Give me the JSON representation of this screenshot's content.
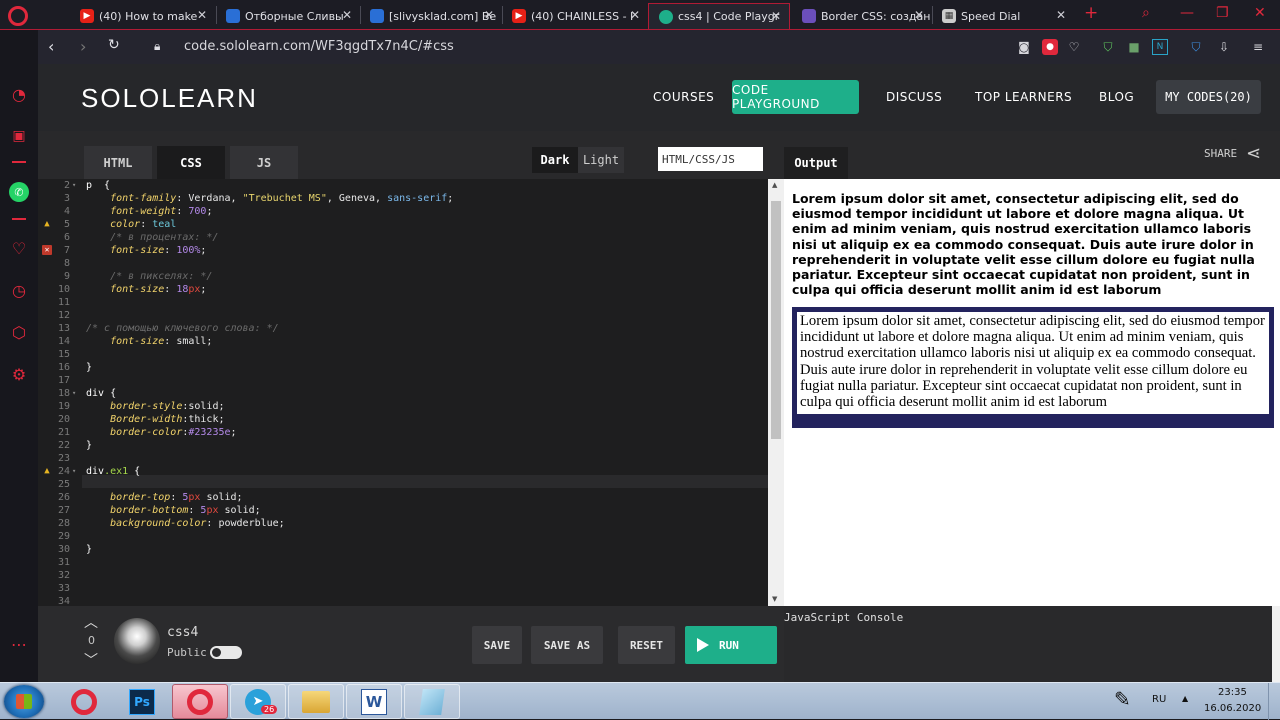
{
  "browser": {
    "tabs": [
      {
        "title": "(40) How to make",
        "icon_color": "#e62117",
        "icon": "youtube-icon"
      },
      {
        "title": "Отборные Сливы",
        "icon_color": "#2a6fd6",
        "icon": "site-icon"
      },
      {
        "title": "[slivysklad.com] Be",
        "icon_color": "#2a6fd6",
        "icon": "site-icon"
      },
      {
        "title": "(40) CHAINLESS - I",
        "icon_color": "#e62117",
        "icon": "youtube-icon"
      },
      {
        "title": "css4 | Code Playgr",
        "icon_color": "#1eaf8a",
        "icon": "sololearn-icon",
        "active": true
      },
      {
        "title": "Border CSS: создан",
        "icon_color": "#6b4fbb",
        "icon": "shield-icon"
      },
      {
        "title": "Speed Dial",
        "icon_color": "#cccccc",
        "icon": "grid-icon"
      }
    ],
    "new_tab_label": "+",
    "url": "code.sololearn.com/WF3qgdTx7n4C/#css"
  },
  "header": {
    "logo": "SOLOLEARN",
    "nav": [
      "COURSES",
      "CODE PLAYGROUND",
      "DISCUSS",
      "TOP LEARNERS",
      "BLOG",
      "MY CODES(20)"
    ]
  },
  "editor": {
    "tabs": [
      "HTML",
      "CSS",
      "JS"
    ],
    "active_tab": "CSS",
    "theme_dark": "Dark",
    "theme_light": "Light",
    "language_box": "HTML/CSS/JS"
  },
  "code_lines": [
    {
      "n": "2",
      "fold": true,
      "parts": [
        [
          "k",
          "p  {"
        ]
      ]
    },
    {
      "n": "3",
      "parts": [
        [
          "v",
          "    "
        ],
        [
          "p",
          "font-family"
        ],
        [
          "v",
          ": Verdana, "
        ],
        [
          "s",
          "\"Trebuchet MS\""
        ],
        [
          "v",
          ", Geneva, "
        ],
        [
          "vbl",
          "sans-serif"
        ],
        [
          "v",
          ";"
        ]
      ]
    },
    {
      "n": "4",
      "parts": [
        [
          "v",
          "    "
        ],
        [
          "p",
          "font-weight"
        ],
        [
          "v",
          ": "
        ],
        [
          "n",
          "700"
        ],
        [
          "v",
          ";"
        ]
      ]
    },
    {
      "n": "5",
      "mark": "warn",
      "parts": [
        [
          "v",
          "    "
        ],
        [
          "p",
          "color"
        ],
        [
          "v",
          ": "
        ],
        [
          "vt",
          "teal"
        ]
      ]
    },
    {
      "n": "6",
      "parts": [
        [
          "c",
          "    /* в процентах: */"
        ]
      ]
    },
    {
      "n": "7",
      "mark": "err",
      "parts": [
        [
          "v",
          "    "
        ],
        [
          "p",
          "font-size"
        ],
        [
          "v",
          ": "
        ],
        [
          "n",
          "100%"
        ],
        [
          "v",
          ";"
        ]
      ]
    },
    {
      "n": "8",
      "parts": []
    },
    {
      "n": "9",
      "parts": [
        [
          "c",
          "    /* в пикселях: */"
        ]
      ]
    },
    {
      "n": "10",
      "parts": [
        [
          "v",
          "    "
        ],
        [
          "p",
          "font-size"
        ],
        [
          "v",
          ": "
        ],
        [
          "n",
          "18"
        ],
        [
          "u",
          "px"
        ],
        [
          "v",
          ";"
        ]
      ]
    },
    {
      "n": "11",
      "parts": []
    },
    {
      "n": "12",
      "parts": []
    },
    {
      "n": "13",
      "parts": [
        [
          "c",
          "/* с помощью ключевого слова: */"
        ]
      ]
    },
    {
      "n": "14",
      "parts": [
        [
          "v",
          "    "
        ],
        [
          "p",
          "font-size"
        ],
        [
          "v",
          ": small;"
        ]
      ]
    },
    {
      "n": "15",
      "parts": []
    },
    {
      "n": "16",
      "parts": [
        [
          "k",
          "}"
        ]
      ]
    },
    {
      "n": "17",
      "parts": []
    },
    {
      "n": "18",
      "fold": true,
      "parts": [
        [
          "k",
          "div {"
        ]
      ]
    },
    {
      "n": "19",
      "parts": [
        [
          "v",
          "    "
        ],
        [
          "p",
          "border-style"
        ],
        [
          "v",
          ":solid;"
        ]
      ]
    },
    {
      "n": "20",
      "parts": [
        [
          "v",
          "    "
        ],
        [
          "p",
          "Border-width"
        ],
        [
          "v",
          ":thick;"
        ]
      ]
    },
    {
      "n": "21",
      "parts": [
        [
          "v",
          "    "
        ],
        [
          "p",
          "border-color"
        ],
        [
          "v",
          ":"
        ],
        [
          "n",
          "#23235e"
        ],
        [
          "v",
          ";"
        ]
      ]
    },
    {
      "n": "22",
      "parts": [
        [
          "k",
          "}"
        ]
      ]
    },
    {
      "n": "23",
      "parts": []
    },
    {
      "n": "24",
      "fold": true,
      "mark": "warn",
      "parts": [
        [
          "k",
          "div"
        ],
        [
          "g",
          ".ex1"
        ],
        [
          "k",
          " {"
        ]
      ]
    },
    {
      "n": "25",
      "parts": []
    },
    {
      "n": "26",
      "parts": [
        [
          "v",
          "    "
        ],
        [
          "p",
          "border-top"
        ],
        [
          "v",
          ": "
        ],
        [
          "n",
          "5"
        ],
        [
          "u",
          "px"
        ],
        [
          "v",
          " solid;"
        ]
      ]
    },
    {
      "n": "27",
      "parts": [
        [
          "v",
          "    "
        ],
        [
          "p",
          "border-bottom"
        ],
        [
          "v",
          ": "
        ],
        [
          "n",
          "5"
        ],
        [
          "u",
          "px"
        ],
        [
          "v",
          " solid;"
        ]
      ]
    },
    {
      "n": "28",
      "parts": [
        [
          "v",
          "    "
        ],
        [
          "p",
          "background-color"
        ],
        [
          "v",
          ": powderblue;"
        ]
      ]
    },
    {
      "n": "29",
      "parts": []
    },
    {
      "n": "30",
      "parts": [
        [
          "k",
          "}"
        ]
      ]
    },
    {
      "n": "31",
      "parts": []
    },
    {
      "n": "32",
      "parts": []
    },
    {
      "n": "33",
      "parts": []
    },
    {
      "n": "34",
      "parts": []
    }
  ],
  "output": {
    "tab": "Output",
    "share": "SHARE",
    "paragraph": "Lorem ipsum dolor sit amet, consectetur adipiscing elit, sed do eiusmod tempor incididunt ut labore et dolore magna aliqua. Ut enim ad minim veniam, quis nostrud exercitation ullamco laboris nisi ut aliquip ex ea commodo consequat. Duis aute irure dolor in reprehenderit in voluptate velit esse cillum dolore eu fugiat nulla pariatur. Excepteur sint occaecat cupidatat non proident, sunt in culpa qui officia deserunt mollit anim id est laborum",
    "div_text": "Lorem ipsum dolor sit amet, consectetur adipiscing elit, sed do eiusmod tempor incididunt ut labore et dolore magna aliqua. Ut enim ad minim veniam, quis nostrud exercitation ullamco laboris nisi ut aliquip ex ea commodo consequat. Duis aute irure dolor in reprehenderit in voluptate velit esse cillum dolore eu fugiat nulla pariatur. Excepteur sint occaecat cupidatat non proident, sunt in culpa qui officia deserunt mollit anim id est laborum",
    "border_color": "#23235e"
  },
  "bottom": {
    "votes": "0",
    "code_name": "css4",
    "public_label": "Public",
    "save": "SAVE",
    "save_as": "SAVE AS",
    "reset": "RESET",
    "run": "RUN",
    "console_title": "JavaScript Console"
  },
  "taskbar": {
    "apps": [
      "Opera",
      "Ps",
      "Opera",
      "Telegram",
      "Explorer",
      "W",
      "Notepad"
    ],
    "telegram_badge": "26",
    "lang": "RU",
    "time": "23:35",
    "date": "16.06.2020"
  },
  "colors": {
    "accent": "#1eaf8a",
    "opera_red": "#e0283c"
  }
}
